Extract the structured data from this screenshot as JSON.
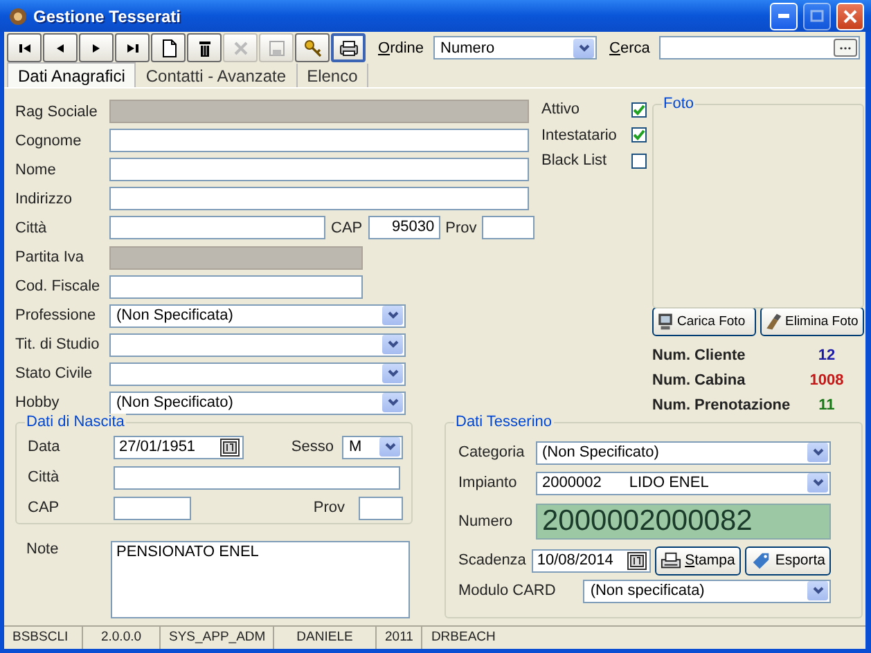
{
  "window": {
    "title": "Gestione Tesserati"
  },
  "toolbar": {
    "buttons": [
      {
        "kind": "first",
        "disabled": false,
        "active": false
      },
      {
        "kind": "prev",
        "disabled": false,
        "active": false
      },
      {
        "kind": "next",
        "disabled": false,
        "active": false
      },
      {
        "kind": "last",
        "disabled": false,
        "active": false
      },
      {
        "kind": "new",
        "disabled": false,
        "active": false
      },
      {
        "kind": "delete",
        "disabled": false,
        "active": false
      },
      {
        "kind": "cancel",
        "disabled": true,
        "active": false
      },
      {
        "kind": "save",
        "disabled": true,
        "active": false
      },
      {
        "kind": "key",
        "disabled": false,
        "active": false
      },
      {
        "kind": "print",
        "disabled": false,
        "active": true
      }
    ],
    "ordine": {
      "label": "Ordine",
      "value": "Numero"
    },
    "cerca": {
      "label": "Cerca"
    }
  },
  "tabs": [
    {
      "label": "Dati Anagrafici",
      "selected": true
    },
    {
      "label": "Contatti - Avanzate",
      "selected": false
    },
    {
      "label": "Elenco",
      "selected": false
    }
  ],
  "anagrafica": [
    {
      "label": "Rag Sociale",
      "kind": "text",
      "disabled": true
    },
    {
      "label": "Cognome",
      "kind": "text",
      "disabled": false
    },
    {
      "label": "Nome",
      "kind": "text",
      "disabled": false
    },
    {
      "label": "Indirizzo",
      "kind": "text",
      "disabled": false
    },
    {
      "label": "Città",
      "kind": "city",
      "cap_label": "CAP",
      "cap": "95030",
      "prov_label": "Prov"
    },
    {
      "label": "Partita Iva",
      "kind": "short_text",
      "disabled": true
    },
    {
      "label": "Cod. Fiscale",
      "kind": "short_text",
      "disabled": false
    },
    {
      "label": "Professione",
      "kind": "select",
      "value": "(Non Specificata)"
    },
    {
      "label": "Tit. di Studio",
      "kind": "select"
    },
    {
      "label": "Stato Civile",
      "kind": "select"
    },
    {
      "label": "Hobby",
      "kind": "select",
      "value": "(Non Specificato)"
    }
  ],
  "flags": [
    {
      "label": "Attivo",
      "checked": true
    },
    {
      "label": "Intestatario",
      "checked": true
    },
    {
      "label": "Black List",
      "checked": false
    }
  ],
  "foto": {
    "title": "Foto",
    "buttons": [
      {
        "label": "Carica Foto",
        "kind": "upload"
      },
      {
        "label": "Elimina Foto",
        "kind": "erase"
      }
    ]
  },
  "counters": [
    {
      "label": "Num. Cliente",
      "value": "12",
      "color": "#1c1ca8"
    },
    {
      "label": "Num. Cabina",
      "value": "1008",
      "color": "#c41818"
    },
    {
      "label": "Num. Prenotazione",
      "value": "11",
      "color": "#187818"
    }
  ],
  "nascita": {
    "title": "Dati di Nascita",
    "data_label": "Data",
    "data": "27/01/1951",
    "sesso_label": "Sesso",
    "sesso": "M",
    "citta_label": "Città",
    "cap_label": "CAP",
    "prov_label": "Prov"
  },
  "note": {
    "label": "Note",
    "value": "PENSIONATO ENEL"
  },
  "tesserino": {
    "title": "Dati Tesserino",
    "categoria": {
      "label": "Categoria",
      "value": "(Non Specificato)"
    },
    "impianto": {
      "label": "Impianto",
      "code": "2000002",
      "name": "LIDO ENEL"
    },
    "numero": {
      "label": "Numero",
      "value": "2000002000082"
    },
    "scadenza": {
      "label": "Scadenza",
      "value": "10/08/2014"
    },
    "buttons": [
      {
        "label": "Stampa",
        "kind": "print"
      },
      {
        "label": "Esporta",
        "kind": "export"
      }
    ],
    "modulo": {
      "label": "Modulo CARD",
      "value": "(Non specificata)"
    }
  },
  "status_bar": [
    "BSBSCLI",
    "2.0.0.0",
    "SYS_APP_ADM",
    "DANIELE",
    "2011",
    "DRBEACH"
  ]
}
